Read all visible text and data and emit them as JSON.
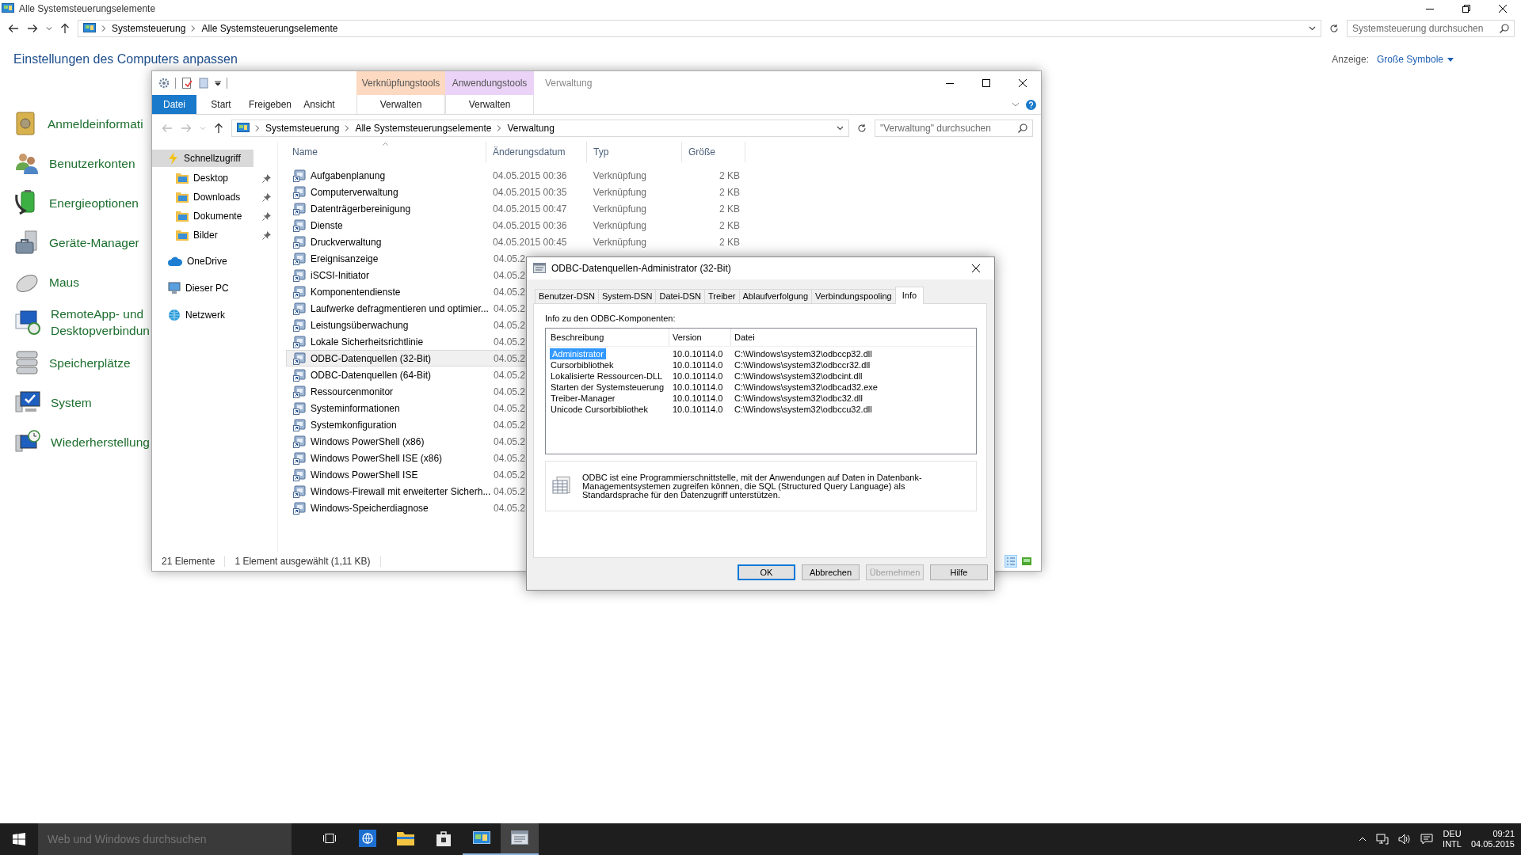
{
  "control_panel": {
    "title": "Alle Systemsteuerungselemente",
    "breadcrumb": [
      "Systemsteuerung",
      "Alle Systemsteuerungselemente"
    ],
    "search": {
      "placeholder": "Systemsteuerung durchsuchen"
    },
    "heading": "Einstellungen des Computers anpassen",
    "view": {
      "label": "Anzeige:",
      "value": "Große Symbole"
    },
    "items": [
      {
        "label": "Anmeldeinformati",
        "kind": "safe"
      },
      {
        "label": "Benutzerkonten",
        "kind": "users"
      },
      {
        "label": "Energieoptionen",
        "kind": "battery"
      },
      {
        "label": "Geräte-Manager",
        "kind": "toolbox"
      },
      {
        "label": "Maus",
        "kind": "mouse"
      },
      {
        "label": "RemoteApp- und Desktopverbindun",
        "kind": "remote"
      },
      {
        "label": "Speicherplätze",
        "kind": "disks"
      },
      {
        "label": "System",
        "kind": "system"
      },
      {
        "label": "Wiederherstellung",
        "kind": "restore"
      }
    ]
  },
  "explorer": {
    "title": "Verwaltung",
    "contextual": [
      {
        "header": "Verknüpfungstools",
        "color": "#fcd9c0",
        "tab": "Verwalten"
      },
      {
        "header": "Anwendungstools",
        "color": "#ead3f7",
        "tab": "Verwalten"
      }
    ],
    "tabs": [
      {
        "label": "Datei",
        "kind": "file"
      },
      {
        "label": "Start",
        "kind": "tab"
      },
      {
        "label": "Freigeben",
        "kind": "tab"
      },
      {
        "label": "Ansicht",
        "kind": "tab"
      }
    ],
    "breadcrumb": [
      "Systemsteuerung",
      "Alle Systemsteuerungselemente",
      "Verwaltung"
    ],
    "search": {
      "placeholder": "\"Verwaltung\" durchsuchen"
    },
    "nav": [
      {
        "label": "Schnellzugriff",
        "kind": "quick",
        "selected": true,
        "children": [
          {
            "label": "Desktop",
            "kind": "folder",
            "pinned": true,
            "selected": false
          },
          {
            "label": "Downloads",
            "kind": "folder",
            "pinned": true,
            "selected": false
          },
          {
            "label": "Dokumente",
            "kind": "folder",
            "pinned": true,
            "selected": false
          },
          {
            "label": "Bilder",
            "kind": "folder",
            "pinned": true,
            "selected": false
          }
        ]
      },
      {
        "label": "OneDrive",
        "kind": "cloud",
        "selected": false
      },
      {
        "label": "Dieser PC",
        "kind": "pc",
        "selected": false
      },
      {
        "label": "Netzwerk",
        "kind": "network",
        "selected": false
      }
    ],
    "columns": [
      "Name",
      "Änderungsdatum",
      "Typ",
      "Größe"
    ],
    "rows": [
      {
        "name": "Aufgabenplanung",
        "date": "04.05.2015 00:36",
        "type": "Verknüpfung",
        "size": "2 KB",
        "selected": false
      },
      {
        "name": "Computerverwaltung",
        "date": "04.05.2015 00:35",
        "type": "Verknüpfung",
        "size": "2 KB",
        "selected": false
      },
      {
        "name": "Datenträgerbereinigung",
        "date": "04.05.2015 00:47",
        "type": "Verknüpfung",
        "size": "2 KB",
        "selected": false
      },
      {
        "name": "Dienste",
        "date": "04.05.2015 00:36",
        "type": "Verknüpfung",
        "size": "2 KB",
        "selected": false
      },
      {
        "name": "Druckverwaltung",
        "date": "04.05.2015 00:45",
        "type": "Verknüpfung",
        "size": "2 KB",
        "selected": false
      },
      {
        "name": "Ereignisanzeige",
        "date": "04.05.2",
        "selected": false
      },
      {
        "name": "iSCSI-Initiator",
        "date": "04.05.2",
        "selected": false
      },
      {
        "name": "Komponentendienste",
        "date": "04.05.2",
        "selected": false
      },
      {
        "name": "Laufwerke defragmentieren und optimier...",
        "date": "04.05.2",
        "selected": false
      },
      {
        "name": "Leistungsüberwachung",
        "date": "04.05.2",
        "selected": false
      },
      {
        "name": "Lokale Sicherheitsrichtlinie",
        "date": "04.05.2",
        "selected": false
      },
      {
        "name": "ODBC-Datenquellen (32-Bit)",
        "date": "04.05.2",
        "selected": true
      },
      {
        "name": "ODBC-Datenquellen (64-Bit)",
        "date": "04.05.2",
        "selected": false
      },
      {
        "name": "Ressourcenmonitor",
        "date": "04.05.2",
        "selected": false
      },
      {
        "name": "Systeminformationen",
        "date": "04.05.2",
        "selected": false
      },
      {
        "name": "Systemkonfiguration",
        "date": "04.05.2",
        "selected": false
      },
      {
        "name": "Windows PowerShell (x86)",
        "date": "04.05.2",
        "selected": false
      },
      {
        "name": "Windows PowerShell ISE (x86)",
        "date": "04.05.2",
        "selected": false
      },
      {
        "name": "Windows PowerShell ISE",
        "date": "04.05.2",
        "selected": false
      },
      {
        "name": "Windows-Firewall mit erweiterter Sicherh...",
        "date": "04.05.2",
        "selected": false
      },
      {
        "name": "Windows-Speicherdiagnose",
        "date": "04.05.2",
        "selected": false
      }
    ],
    "status_bar": {
      "count": "21 Elemente",
      "selection": "1 Element ausgewählt (1,11 KB)"
    }
  },
  "dialog": {
    "title": "ODBC-Datenquellen-Administrator (32-Bit)",
    "tabs": [
      {
        "label": "Benutzer-DSN",
        "selected": false
      },
      {
        "label": "System-DSN",
        "selected": false
      },
      {
        "label": "Datei-DSN",
        "selected": false
      },
      {
        "label": "Treiber",
        "selected": false
      },
      {
        "label": "Ablaufverfolgung",
        "selected": false
      },
      {
        "label": "Verbindungspooling",
        "selected": false
      },
      {
        "label": "Info",
        "selected": true
      }
    ],
    "label": "Info zu den ODBC-Komponenten:",
    "table": {
      "columns": [
        "Beschreibung",
        "Version",
        "Datei"
      ],
      "rows": [
        {
          "cells": [
            "Administrator",
            "10.0.10114.0",
            "C:\\Windows\\system32\\odbccp32.dll"
          ],
          "selected": true
        },
        {
          "cells": [
            "Cursorbibliothek",
            "10.0.10114.0",
            "C:\\Windows\\system32\\odbccr32.dll"
          ],
          "selected": false
        },
        {
          "cells": [
            "Lokalisierte Ressourcen-DLL",
            "10.0.10114.0",
            "C:\\Windows\\system32\\odbcint.dll"
          ],
          "selected": false
        },
        {
          "cells": [
            "Starten der Systemsteuerung",
            "10.0.10114.0",
            "C:\\Windows\\system32\\odbcad32.exe"
          ],
          "selected": false
        },
        {
          "cells": [
            "Treiber-Manager",
            "10.0.10114.0",
            "C:\\Windows\\system32\\odbc32.dll"
          ],
          "selected": false
        },
        {
          "cells": [
            "Unicode Cursorbibliothek",
            "10.0.10114.0",
            "C:\\Windows\\system32\\odbccu32.dll"
          ],
          "selected": false
        }
      ]
    },
    "description": "ODBC ist eine Programmierschnittstelle, mit der Anwendungen auf Daten in Datenbank-Managementsystemen zugreifen können, die SQL (Structured Query Language) als Standardsprache für den Datenzugriff unterstützen.",
    "buttons": [
      {
        "label": "OK",
        "default": true,
        "disabled": false
      },
      {
        "label": "Abbrechen",
        "default": false,
        "disabled": false
      },
      {
        "label": "Übernehmen",
        "default": false,
        "disabled": true
      },
      {
        "label": "Hilfe",
        "default": false,
        "disabled": false
      }
    ]
  },
  "taskbar": {
    "search": {
      "placeholder": "Web und Windows durchsuchen"
    },
    "apps": [
      {
        "kind": "taskview",
        "running": false,
        "active": false
      },
      {
        "kind": "browser",
        "running": false,
        "active": false
      },
      {
        "kind": "explorer",
        "running": false,
        "active": false
      },
      {
        "kind": "store",
        "running": false,
        "active": false
      },
      {
        "kind": "controlpanel",
        "running": true,
        "active": false
      },
      {
        "kind": "odbc",
        "running": true,
        "active": true
      }
    ],
    "language": [
      "DEU",
      "INTL"
    ],
    "time": "09:21",
    "date": "04.05.2015"
  }
}
